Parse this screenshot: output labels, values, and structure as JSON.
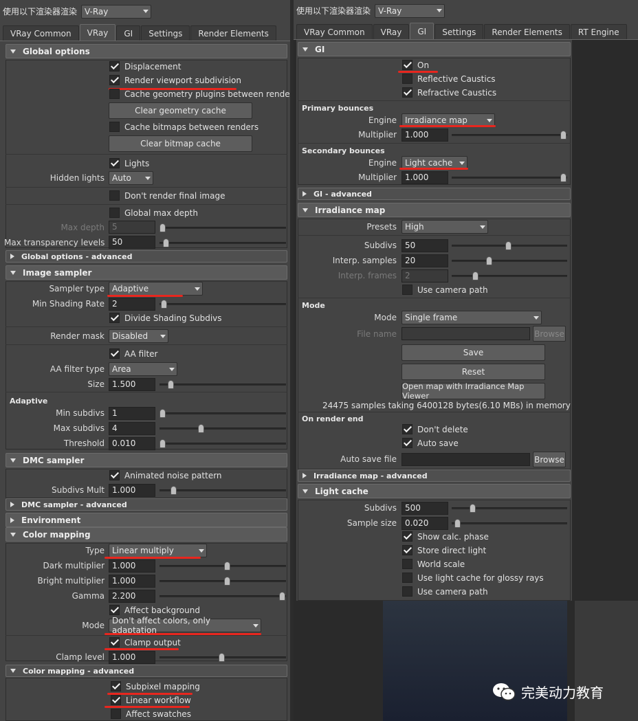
{
  "renderer_label": "使用以下渲染器渲染",
  "renderer_value": "V-Ray",
  "left": {
    "tabs": [
      "VRay Common",
      "VRay",
      "GI",
      "Settings",
      "Render Elements"
    ],
    "active_tab": "VRay",
    "global": {
      "title": "Global options",
      "displacement": "Displacement",
      "render_viewport": "Render viewport subdivision",
      "cache_geo": "Cache geometry plugins between renders",
      "clear_geo": "Clear geometry cache",
      "cache_bitmaps": "Cache bitmaps between renders",
      "clear_bitmap": "Clear bitmap cache",
      "lights": "Lights",
      "hidden_lights_label": "Hidden lights",
      "hidden_lights_value": "Auto",
      "dont_render": "Don't render final image",
      "global_max_depth": "Global max depth",
      "max_depth_label": "Max depth",
      "max_depth_value": "5",
      "max_transp_label": "Max transparency levels",
      "max_transp_value": "50",
      "advanced": "Global options - advanced"
    },
    "sampler": {
      "title": "Image sampler",
      "type_label": "Sampler type",
      "type_value": "Adaptive",
      "min_shading_label": "Min Shading Rate",
      "min_shading_value": "2",
      "divide_shading": "Divide Shading Subdivs",
      "render_mask_label": "Render mask",
      "render_mask_value": "Disabled",
      "aa_filter": "AA filter",
      "aa_type_label": "AA filter type",
      "aa_type_value": "Area",
      "size_label": "Size",
      "size_value": "1.500",
      "adaptive_group": "Adaptive",
      "min_subdivs_label": "Min subdivs",
      "min_subdivs_value": "1",
      "max_subdivs_label": "Max subdivs",
      "max_subdivs_value": "4",
      "threshold_label": "Threshold",
      "threshold_value": "0.010"
    },
    "dmc": {
      "title": "DMC sampler",
      "animated": "Animated noise pattern",
      "subdivs_mult_label": "Subdivs Mult",
      "subdivs_mult_value": "1.000",
      "advanced": "DMC sampler - advanced"
    },
    "environment": {
      "title": "Environment"
    },
    "color": {
      "title": "Color mapping",
      "type_label": "Type",
      "type_value": "Linear multiply",
      "dark_label": "Dark multiplier",
      "dark_value": "1.000",
      "bright_label": "Bright multiplier",
      "bright_value": "1.000",
      "gamma_label": "Gamma",
      "gamma_value": "2.200",
      "affect_bg": "Affect background",
      "mode_label": "Mode",
      "mode_value": "Don't affect colors, only adaptation",
      "clamp_output": "Clamp output",
      "clamp_level_label": "Clamp level",
      "clamp_level_value": "1.000",
      "advanced": "Color mapping - advanced",
      "subpixel": "Subpixel mapping",
      "linear_workflow": "Linear workflow",
      "affect_swatches": "Affect swatches"
    }
  },
  "right": {
    "tabs": [
      "VRay Common",
      "VRay",
      "GI",
      "Settings",
      "Render Elements",
      "RT Engine"
    ],
    "active_tab": "GI",
    "gi": {
      "title": "GI",
      "on": "On",
      "reflective": "Reflective Caustics",
      "refractive": "Refractive Caustics",
      "primary": "Primary bounces",
      "engine_label": "Engine",
      "primary_engine": "Irradiance map",
      "multiplier_label": "Multiplier",
      "primary_mult": "1.000",
      "secondary": "Secondary bounces",
      "secondary_engine": "Light cache",
      "secondary_mult": "1.000",
      "advanced": "GI - advanced"
    },
    "irr": {
      "title": "Irradiance map",
      "presets_label": "Presets",
      "presets_value": "High",
      "subdivs_label": "Subdivs",
      "subdivs_value": "50",
      "interp_samples_label": "Interp. samples",
      "interp_samples_value": "20",
      "interp_frames_label": "Interp. frames",
      "interp_frames_value": "2",
      "use_camera": "Use camera path",
      "mode_group": "Mode",
      "mode_label": "Mode",
      "mode_value": "Single frame",
      "file_label": "File name",
      "browse": "Browse",
      "save": "Save",
      "reset": "Reset",
      "open_map": "Open map with Irradiance Map Viewer",
      "info": "24475 samples taking 6400128 bytes(6.10 MBs) in memory",
      "render_end": "On render end",
      "dont_delete": "Don't delete",
      "auto_save": "Auto save",
      "auto_save_file": "Auto save file",
      "advanced": "Irradiance map - advanced"
    },
    "lc": {
      "title": "Light cache",
      "subdivs_label": "Subdivs",
      "subdivs_value": "500",
      "sample_label": "Sample size",
      "sample_value": "0.020",
      "show_calc": "Show calc. phase",
      "store_direct": "Store direct light",
      "world_scale": "World scale",
      "glossy": "Use light cache for glossy rays",
      "camera_path": "Use camera path"
    }
  },
  "watermark": "完美动力教育",
  "colors": {
    "annotation": "#e8261e"
  }
}
